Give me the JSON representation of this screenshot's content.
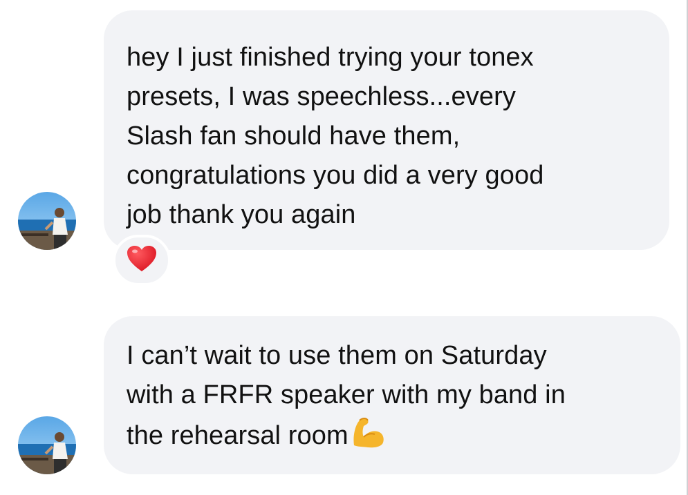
{
  "messages": [
    {
      "text": "hey I just finished trying your tonex\npresets, I was speechless...every\nSlash fan should have them,\ncongratulations you did a very good\njob thank you again",
      "reaction": "heart-emoji"
    },
    {
      "text": "I can’t wait to use them on Saturday\nwith a FRFR speaker with my band in\nthe rehearsal room",
      "trailing_emoji": "flexed-biceps-emoji"
    }
  ],
  "colors": {
    "bubble_bg": "#f2f3f6",
    "text": "#111111",
    "heart": "#e8232f",
    "flex_emoji": "#f5b52c"
  }
}
